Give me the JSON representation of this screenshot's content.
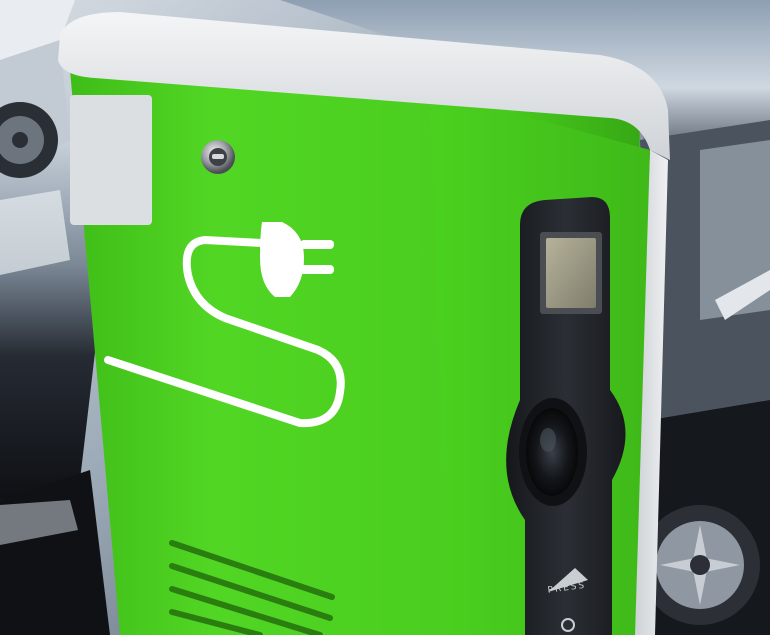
{
  "scene": {
    "subject": "ev-charging-station",
    "icons": [
      "plug-icon",
      "lock-icon",
      "press-arrow-icon"
    ],
    "colors": {
      "housing_green": "#4cd01f",
      "housing_green_shade": "#3cae16",
      "cap_white": "#e6e8ea",
      "side_panel": "#d9dcdf",
      "socket_panel": "#23262b",
      "car_body_dark": "#1b1f26",
      "car_reflection": "#b9c3cf"
    }
  },
  "socket_panel": {
    "button_label": "PRESS"
  }
}
